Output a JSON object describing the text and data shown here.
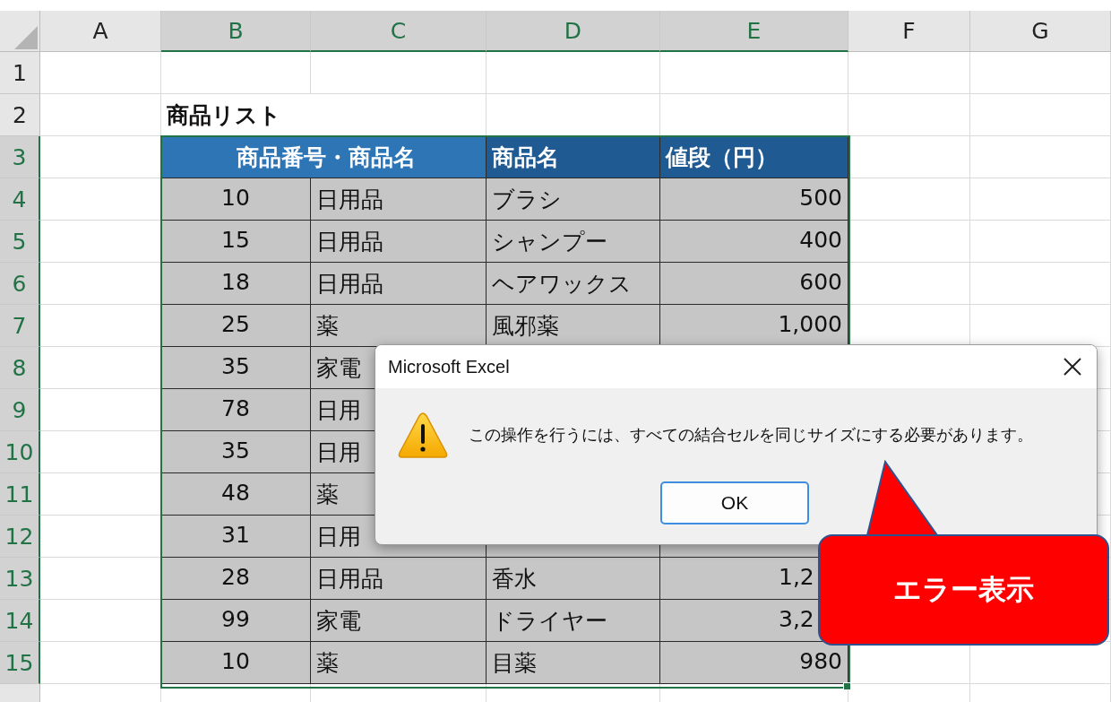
{
  "columns": [
    {
      "letter": "A",
      "selected": false
    },
    {
      "letter": "B",
      "selected": true
    },
    {
      "letter": "C",
      "selected": true
    },
    {
      "letter": "D",
      "selected": true
    },
    {
      "letter": "E",
      "selected": true
    },
    {
      "letter": "F",
      "selected": false
    },
    {
      "letter": "G",
      "selected": false
    }
  ],
  "rows": [
    {
      "number": "1",
      "selected": false
    },
    {
      "number": "2",
      "selected": false,
      "title": "商品リスト"
    },
    {
      "number": "3",
      "selected": true,
      "header": {
        "code_name": "商品番号・商品名",
        "name": "商品名",
        "price": "値段（円）"
      }
    },
    {
      "number": "4",
      "selected": true,
      "code": "10",
      "category": "日用品",
      "name": "ブラシ",
      "price": "500"
    },
    {
      "number": "5",
      "selected": true,
      "code": "15",
      "category": "日用品",
      "name": "シャンプー",
      "price": "400"
    },
    {
      "number": "6",
      "selected": true,
      "code": "18",
      "category": "日用品",
      "name": "ヘアワックス",
      "price": "600"
    },
    {
      "number": "7",
      "selected": true,
      "code": "25",
      "category": "薬",
      "name": "風邪薬",
      "price": "1,000"
    },
    {
      "number": "8",
      "selected": true,
      "code": "35",
      "category": "家電"
    },
    {
      "number": "9",
      "selected": true,
      "code": "78",
      "category": "日用"
    },
    {
      "number": "10",
      "selected": true,
      "code": "35",
      "category": "日用"
    },
    {
      "number": "11",
      "selected": true,
      "code": "48",
      "category": "薬"
    },
    {
      "number": "12",
      "selected": true,
      "code": "31",
      "category": "日用"
    },
    {
      "number": "13",
      "selected": true,
      "code": "28",
      "category": "日用品",
      "name": "香水",
      "price": "1,2",
      "price_cut": true
    },
    {
      "number": "14",
      "selected": true,
      "code": "99",
      "category": "家電",
      "name": "ドライヤー",
      "price": "3,2",
      "price_cut": true
    },
    {
      "number": "15",
      "selected": true,
      "code": "10",
      "category": "薬",
      "name": "目薬",
      "price": "980"
    }
  ],
  "dialog": {
    "title": "Microsoft Excel",
    "message": "この操作を行うには、すべての結合セルを同じサイズにする必要があります。",
    "button": "OK"
  },
  "callout": {
    "text": "エラー表示"
  }
}
